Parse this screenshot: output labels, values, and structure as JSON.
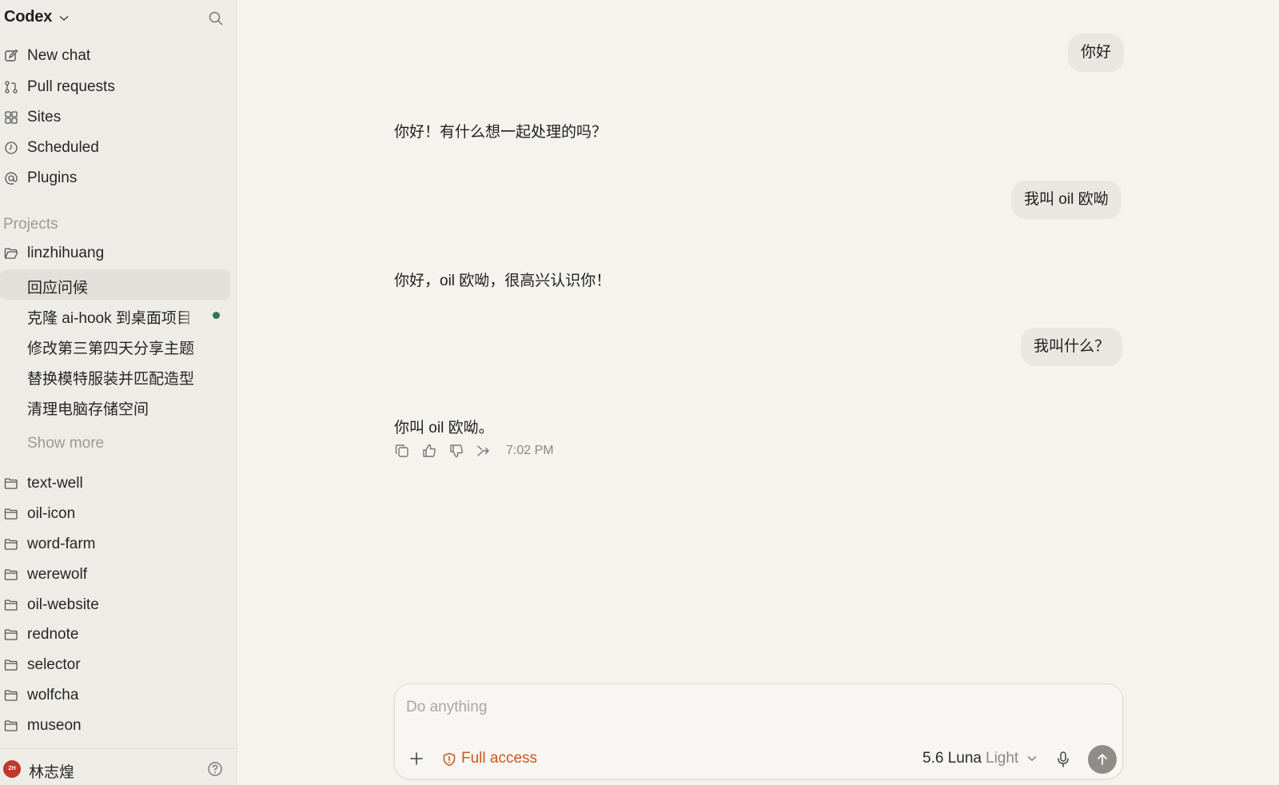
{
  "sidebar": {
    "app_title": "Codex",
    "nav": [
      {
        "label": "New chat",
        "icon": "edit-icon"
      },
      {
        "label": "Pull requests",
        "icon": "pull-request-icon"
      },
      {
        "label": "Sites",
        "icon": "grid-icon"
      },
      {
        "label": "Scheduled",
        "icon": "clock-icon"
      },
      {
        "label": "Plugins",
        "icon": "at-icon"
      }
    ],
    "projects_label": "Projects",
    "active_project": "linzhihuang",
    "chats": [
      {
        "label": "回应问候",
        "active": true
      },
      {
        "label": "克隆 ai-hook 到桌面项目",
        "unread": true
      },
      {
        "label": "修改第三第四天分享主题"
      },
      {
        "label": "替换模特服装并匹配造型"
      },
      {
        "label": "清理电脑存储空间"
      }
    ],
    "show_more": "Show more",
    "projects": [
      "text-well",
      "oil-icon",
      "word-farm",
      "werewolf",
      "oil-website",
      "rednote",
      "selector",
      "wolfcha",
      "museon"
    ],
    "user": {
      "initials": "ZH",
      "name": "林志煌",
      "avatar_color": "#c0392b"
    }
  },
  "conversation": {
    "user_messages": [
      "你好",
      "我叫 oil 欧呦",
      "我叫什么？"
    ],
    "assistant_messages": [
      "你好！有什么想一起处理的吗？",
      "你好，oil 欧呦，很高兴认识你！",
      "你叫 oil 欧呦。"
    ],
    "last_message_time": "7:02 PM"
  },
  "composer": {
    "placeholder": "Do anything",
    "access_label": "Full access",
    "access_color": "#c9581f",
    "model_name": "5.6 Luna",
    "model_mode": "Light"
  }
}
